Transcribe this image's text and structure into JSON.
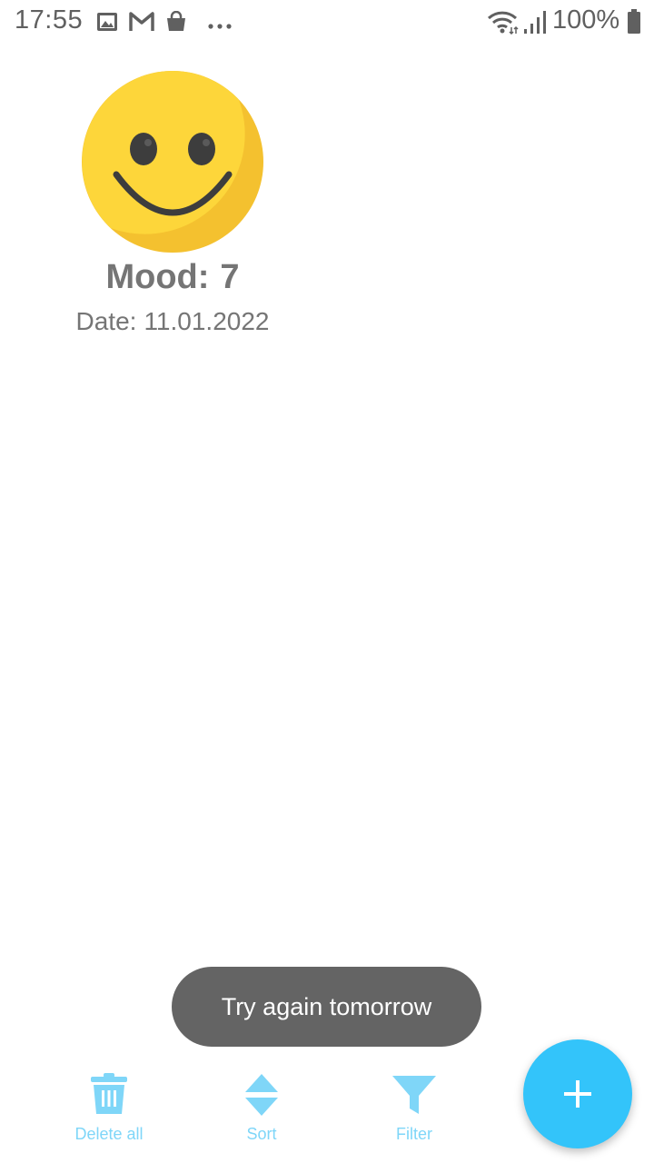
{
  "status_bar": {
    "time": "17:55",
    "battery": "100%",
    "icons": [
      "image-icon",
      "gmail-icon",
      "shopping-bag-icon",
      "more-dots-icon",
      "wifi-icon",
      "signal-icon",
      "battery-icon"
    ]
  },
  "entries": [
    {
      "face": "smiley-icon",
      "mood_label": "Mood:",
      "mood_value": "7",
      "date_label": "Date:",
      "date_value": "11.01.2022"
    }
  ],
  "toast": {
    "message": "Try again tomorrow"
  },
  "bottom_bar": {
    "delete_all": "Delete all",
    "sort": "Sort",
    "filter": "Filter"
  },
  "colors": {
    "accent": "#33c4fa",
    "accent_light": "#7fd6f8",
    "face_yellow": "#fdd63a",
    "face_shade": "#f4c12f",
    "toast_bg": "#646464",
    "text_gray": "#757575"
  }
}
